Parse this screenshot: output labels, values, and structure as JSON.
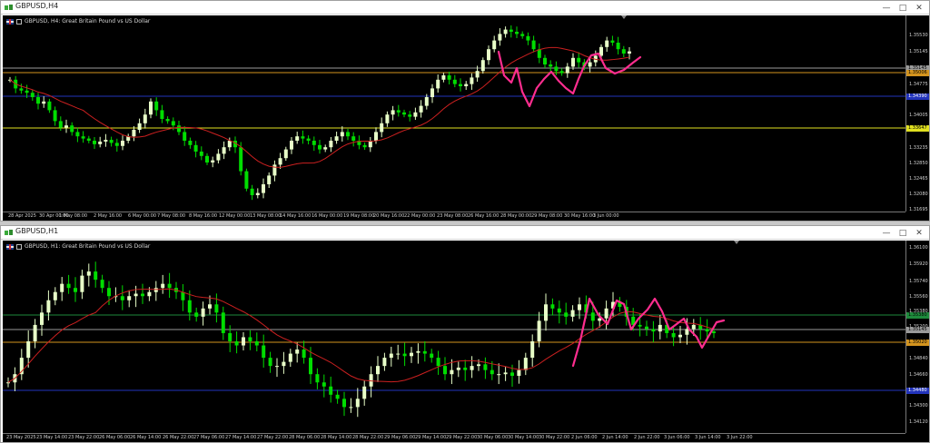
{
  "windows": [
    {
      "title": "GBPUSD,H4",
      "legend": "GBPUSD, H4:  Great Britain Pound vs US Dollar",
      "price_ticks": [
        "1.35530",
        "1.35145",
        "1.35006",
        "1.34775",
        "1.34390",
        "1.34005",
        "1.33647",
        "1.33235",
        "1.32850",
        "1.32465",
        "1.32080",
        "1.31695"
      ],
      "time_ticks": [
        "28 Apr 2025",
        "30 Apr 00:00",
        "1 May 08:00",
        "2 May 16:00",
        "6 May 00:00",
        "7 May 08:00",
        "8 May 16:00",
        "12 May 00:00",
        "13 May 08:00",
        "14 May 16:00",
        "16 May 00:00",
        "19 May 08:00",
        "20 May 16:00",
        "22 May 00:00",
        "23 May 08:00",
        "26 May 16:00",
        "28 May 00:00",
        "29 May 08:00",
        "30 May 16:00",
        "3 Jun 00:00"
      ],
      "price_boxes": [
        {
          "text": "1.35145",
          "bg": "#9a9a9a",
          "fg": "#000000"
        },
        {
          "text": "1.35006",
          "bg": "#d4941e",
          "fg": "#000000"
        },
        {
          "text": "1.34390",
          "bg": "#2233bb",
          "fg": "#ffffff"
        },
        {
          "text": "1.33647",
          "bg": "#e0e020",
          "fg": "#000000"
        }
      ]
    },
    {
      "title": "GBPUSD,H1",
      "legend": "GBPUSD, H1:  Great Britain Pound vs US Dollar",
      "price_ticks": [
        "1.36100",
        "1.35920",
        "1.35740",
        "1.35560",
        "1.35380",
        "1.35200",
        "1.35145",
        "1.35020",
        "1.34840",
        "1.34660",
        "1.34480",
        "1.34300",
        "1.34120"
      ],
      "time_ticks": [
        "23 May 2025",
        "23 May 14:00",
        "23 May 22:00",
        "26 May 06:00",
        "26 May 14:00",
        "26 May 22:00",
        "27 May 06:00",
        "27 May 14:00",
        "27 May 22:00",
        "28 May 06:00",
        "28 May 14:00",
        "28 May 22:00",
        "29 May 06:00",
        "29 May 14:00",
        "29 May 22:00",
        "30 May 06:00",
        "30 May 14:00",
        "30 May 22:00",
        "2 Jun 06:00",
        "2 Jun 14:00",
        "2 Jun 22:00",
        "3 Jun 06:00",
        "3 Jun 14:00",
        "3 Jun 22:00"
      ],
      "price_boxes": [
        {
          "text": "1.35380",
          "bg": "#1e8a3c",
          "fg": "#000000"
        },
        {
          "text": "1.35145",
          "bg": "#9a9a9a",
          "fg": "#000000"
        },
        {
          "text": "1.35020",
          "bg": "#d4941e",
          "fg": "#000000"
        },
        {
          "text": "1.34480",
          "bg": "#2233bb",
          "fg": "#ffffff"
        }
      ]
    }
  ],
  "colors": {
    "bull_candle": "#e8ffc8",
    "bear_candle": "#00dd00",
    "moving_average": "#cc2020",
    "pattern_line": "#ff2d8f",
    "level_orange": "#d4941e",
    "level_blue": "#2233bb",
    "level_yellow": "#e0e020",
    "level_green": "#1e8a3c",
    "level_gray": "#9a9a9a"
  },
  "icons": [
    "chart-app-icon",
    "minimize-icon",
    "restore-icon",
    "close-icon"
  ],
  "chart_data": [
    {
      "type": "candlestick",
      "symbol": "GBPUSD",
      "timeframe": "H4",
      "ylim": [
        1.315,
        1.3575
      ],
      "close": [
        1.344,
        1.342,
        1.3415,
        1.341,
        1.34,
        1.3385,
        1.339,
        1.337,
        1.3345,
        1.333,
        1.3335,
        1.332,
        1.331,
        1.3305,
        1.33,
        1.3292,
        1.3298,
        1.3302,
        1.3295,
        1.3288,
        1.33,
        1.331,
        1.3325,
        1.334,
        1.336,
        1.339,
        1.337,
        1.335,
        1.3345,
        1.3335,
        1.332,
        1.33,
        1.329,
        1.3275,
        1.3265,
        1.325,
        1.3255,
        1.327,
        1.3285,
        1.33,
        1.3285,
        1.323,
        1.319,
        1.3175,
        1.318,
        1.32,
        1.322,
        1.3245,
        1.326,
        1.328,
        1.33,
        1.331,
        1.3305,
        1.33,
        1.329,
        1.328,
        1.3285,
        1.33,
        1.331,
        1.332,
        1.331,
        1.33,
        1.329,
        1.3285,
        1.33,
        1.332,
        1.334,
        1.336,
        1.337,
        1.3365,
        1.336,
        1.3355,
        1.3365,
        1.338,
        1.34,
        1.342,
        1.344,
        1.345,
        1.344,
        1.343,
        1.3425,
        1.343,
        1.3445,
        1.346,
        1.3485,
        1.351,
        1.353,
        1.3545,
        1.3555,
        1.355,
        1.3545,
        1.354,
        1.353,
        1.351,
        1.349,
        1.3475,
        1.347,
        1.346,
        1.3455,
        1.347,
        1.349,
        1.348,
        1.347,
        1.348,
        1.3495,
        1.3515,
        1.353,
        1.3525,
        1.351,
        1.35,
        1.3505
      ]
    },
    {
      "type": "candlestick",
      "symbol": "GBPUSD",
      "timeframe": "H1",
      "ylim": [
        1.3405,
        1.3615
      ],
      "close": [
        1.346,
        1.347,
        1.349,
        1.351,
        1.353,
        1.3545,
        1.356,
        1.357,
        1.358,
        1.3575,
        1.357,
        1.359,
        1.3595,
        1.3585,
        1.3575,
        1.3565,
        1.3565,
        1.356,
        1.3565,
        1.3568,
        1.3565,
        1.357,
        1.3575,
        1.358,
        1.3575,
        1.357,
        1.356,
        1.3545,
        1.354,
        1.355,
        1.3555,
        1.3545,
        1.352,
        1.351,
        1.3505,
        1.3515,
        1.351,
        1.3505,
        1.349,
        1.348,
        1.348,
        1.3485,
        1.3495,
        1.35,
        1.349,
        1.347,
        1.346,
        1.3455,
        1.3445,
        1.344,
        1.343,
        1.343,
        1.344,
        1.3455,
        1.347,
        1.348,
        1.349,
        1.3495,
        1.3495,
        1.3492,
        1.3496,
        1.3498,
        1.3495,
        1.349,
        1.348,
        1.347,
        1.3475,
        1.3478,
        1.3475,
        1.348,
        1.3482,
        1.3475,
        1.347,
        1.347,
        1.3472,
        1.3468,
        1.3475,
        1.349,
        1.351,
        1.3535,
        1.3555,
        1.355,
        1.3545,
        1.354,
        1.3548,
        1.3555,
        1.3545,
        1.3535,
        1.3538,
        1.355,
        1.3558,
        1.3552,
        1.354,
        1.353,
        1.3528,
        1.3525,
        1.3522,
        1.353,
        1.352,
        1.3515,
        1.3518,
        1.3525,
        1.353,
        1.3525,
        1.3522,
        1.352
      ]
    }
  ]
}
